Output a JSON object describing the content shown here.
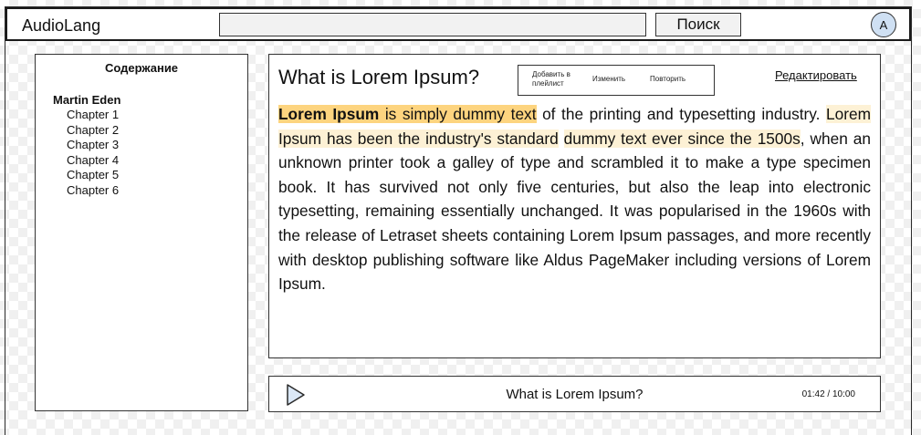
{
  "header": {
    "app_title": "AudioLang",
    "search_value": "",
    "search_button_label": "Поиск",
    "avatar_initial": "A"
  },
  "toc": {
    "heading": "Содержание",
    "book_title": "Martin Eden",
    "chapters": [
      "Chapter 1",
      "Chapter 2",
      "Chapter 3",
      "Chapter 4",
      "Chapter 5",
      "Chapter 6"
    ]
  },
  "reader": {
    "title": "What is Lorem Ipsum?",
    "actions": {
      "add_to_playlist": "Добавить в плейлист",
      "change": "Изменить",
      "repeat": "Повторить"
    },
    "edit_link": "Редактировать",
    "segments": [
      {
        "text": "Lorem Ipsum",
        "style": "strong",
        "bold": true
      },
      {
        "text": " is simply dummy text",
        "style": "strong",
        "bold": false
      },
      {
        "text": " of the printing and typesetting industry. ",
        "style": "none",
        "bold": false
      },
      {
        "text": "Lorem Ipsum has been the industry's standard",
        "style": "soft",
        "bold": false
      },
      {
        "text": " ",
        "style": "none",
        "bold": false
      },
      {
        "text": "dummy text ever since the 1500s",
        "style": "soft",
        "bold": false
      },
      {
        "text": ", when an unknown printer took a galley of type and scrambled it to make a type specimen book. It has survived not only five centuries, but also the leap into electronic typesetting, remaining essentially unchanged. It was popularised in the 1960s with the release of Letraset sheets containing Lorem Ipsum passages, and more recently with desktop publishing software like Aldus PageMaker including versions of Lorem Ipsum.",
        "style": "none",
        "bold": false
      }
    ],
    "highlight_colors": {
      "strong": "#fdd47f",
      "soft": "#fdf1d5"
    }
  },
  "player": {
    "play_icon": "play-icon",
    "track_title": "What is Lorem Ipsum?",
    "time": "01:42 / 10:00"
  }
}
